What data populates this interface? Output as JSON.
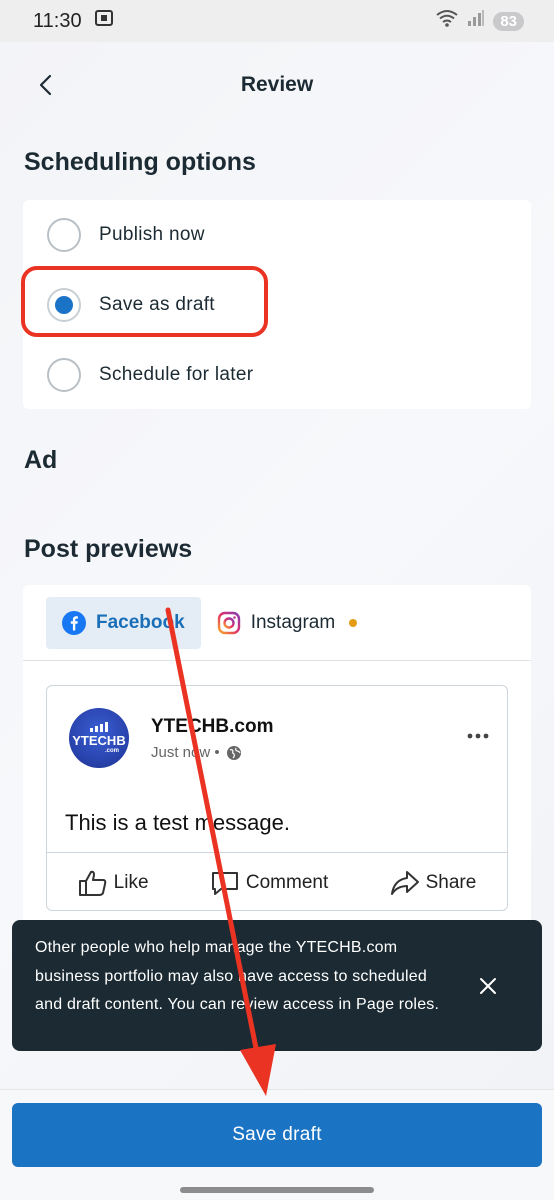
{
  "status_bar": {
    "time": "11:30",
    "battery": "83"
  },
  "header": {
    "title": "Review"
  },
  "scheduling": {
    "title": "Scheduling options",
    "options": [
      {
        "label": "Publish now",
        "selected": false
      },
      {
        "label": "Save as draft",
        "selected": true
      },
      {
        "label": "Schedule for later",
        "selected": false
      }
    ]
  },
  "ad": {
    "title": "Ad"
  },
  "previews": {
    "title": "Post previews",
    "tabs": [
      {
        "label": "Facebook",
        "active": true
      },
      {
        "label": "Instagram",
        "active": false
      }
    ],
    "post": {
      "avatar_text": "YTECHB",
      "avatar_sub": ".com",
      "page_name": "YTECHB.com",
      "time": "Just now •",
      "message": "This is a test message.",
      "actions": [
        "Like",
        "Comment",
        "Share"
      ]
    }
  },
  "toast": {
    "message": "Other people who help manage the YTECHB.com business portfolio may also have access to scheduled and draft content. You can review access in Page roles."
  },
  "footer": {
    "primary_label": "Save draft"
  },
  "colors": {
    "primary": "#1b73c4",
    "text": "#1c2b33",
    "highlight": "#ea3323",
    "toast_bg": "#1c2b33"
  }
}
